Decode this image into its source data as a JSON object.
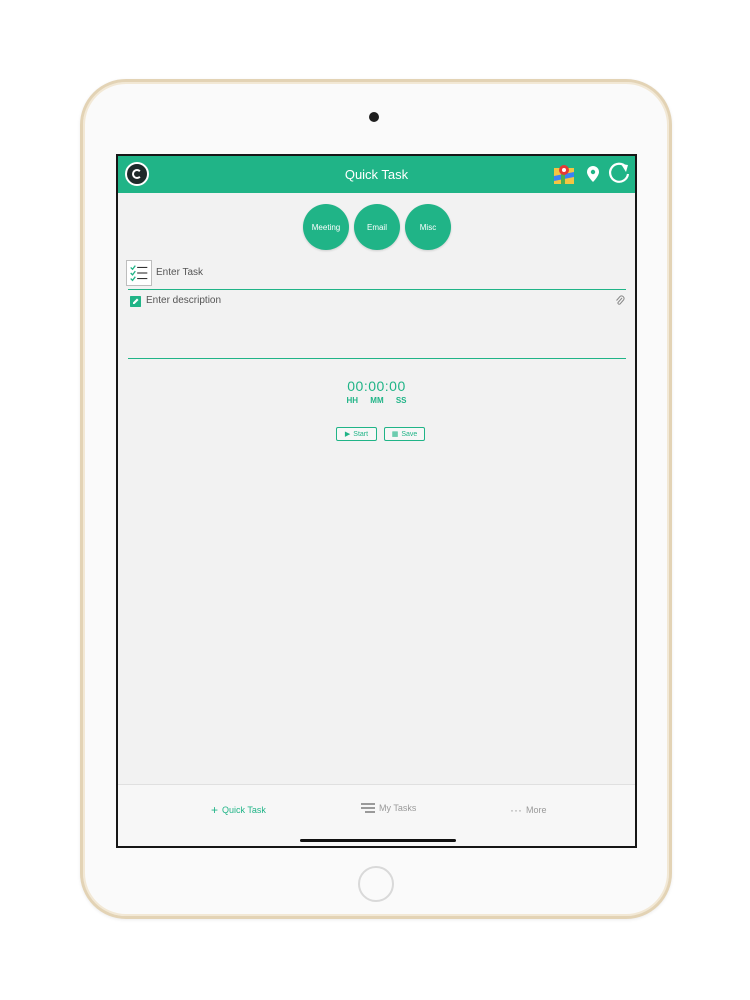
{
  "header": {
    "title": "Quick Task"
  },
  "categories": [
    {
      "label": "Meeting"
    },
    {
      "label": "Email"
    },
    {
      "label": "Misc"
    }
  ],
  "task": {
    "placeholder": "Enter Task"
  },
  "description": {
    "placeholder": "Enter description"
  },
  "timer": {
    "value": "00:00:00",
    "labels": [
      "HH",
      "MM",
      "SS"
    ]
  },
  "actions": {
    "start_label": "Start",
    "save_label": "Save"
  },
  "tabs": [
    {
      "label": "Quick Task",
      "icon": "plus-icon",
      "active": true
    },
    {
      "label": "My Tasks",
      "icon": "list-icon",
      "active": false
    },
    {
      "label": "More",
      "icon": "ellipsis-icon",
      "active": false
    }
  ],
  "colors": {
    "accent": "#20b487",
    "background": "#f2f2f2",
    "tab_inactive": "#9a9a9a"
  }
}
